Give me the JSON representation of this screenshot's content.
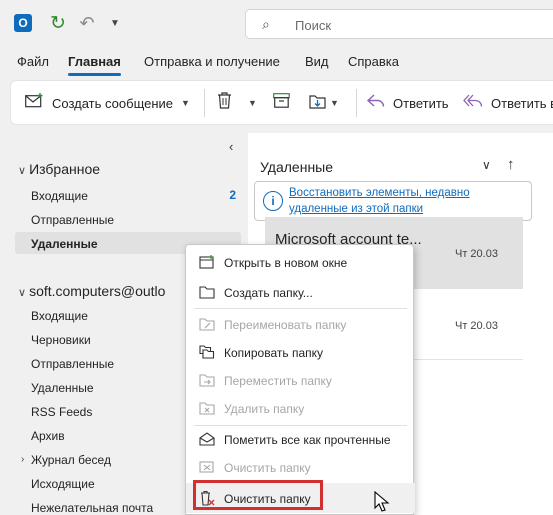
{
  "quick_access": {
    "app_icon": "outlook-icon",
    "sync_icon": "sync-icon",
    "undo_icon": "undo-icon",
    "more_icon": "chevron-down-icon"
  },
  "search": {
    "placeholder": "Поиск"
  },
  "tabs": [
    {
      "label": "Файл"
    },
    {
      "label": "Главная",
      "active": true
    },
    {
      "label": "Отправка и получение"
    },
    {
      "label": "Вид"
    },
    {
      "label": "Справка"
    }
  ],
  "ribbon": {
    "new_message": "Создать сообщение",
    "reply": "Ответить",
    "reply_all": "Ответить в"
  },
  "folders": {
    "favorites_label": "Избранное",
    "favorites": [
      {
        "label": "Входящие",
        "count": "2"
      },
      {
        "label": "Отправленные"
      },
      {
        "label": "Удаленные",
        "selected": true
      }
    ],
    "account_label": "soft.computers@outlo",
    "account_folders": [
      {
        "label": "Входящие"
      },
      {
        "label": "Черновики"
      },
      {
        "label": "Отправленные"
      },
      {
        "label": "Удаленные"
      },
      {
        "label": "RSS Feeds"
      },
      {
        "label": "Архив"
      },
      {
        "label": "Журнал бесед"
      },
      {
        "label": "Исходящие"
      },
      {
        "label": "Нежелательная почта"
      }
    ]
  },
  "message_list": {
    "title": "Удаленные",
    "restore_banner": "Восстановить элементы, недавно удаленные из этой папки",
    "messages": [
      {
        "sender": "Microsoft account te...",
        "date": "Чт 20.03"
      },
      {
        "date": "Чт 20.03"
      }
    ]
  },
  "context_menu": [
    {
      "label": "Открыть в новом окне",
      "icon": "open-window-icon",
      "disabled": false
    },
    {
      "label": "Создать папку...",
      "icon": "new-folder-icon",
      "disabled": false
    },
    {
      "label": "Переименовать папку",
      "icon": "rename-folder-icon",
      "disabled": true
    },
    {
      "label": "Копировать папку",
      "icon": "copy-folder-icon",
      "disabled": false
    },
    {
      "label": "Переместить папку",
      "icon": "move-folder-icon",
      "disabled": true
    },
    {
      "label": "Удалить папку",
      "icon": "delete-folder-icon",
      "disabled": true
    },
    {
      "label": "Пометить все как прочтенные",
      "icon": "mark-read-icon",
      "disabled": false
    },
    {
      "label": "Очистить папку",
      "icon": "clean-folder-icon",
      "disabled": true
    },
    {
      "label": "Очистить папку",
      "icon": "empty-folder-icon",
      "disabled": false,
      "highlighted": true
    }
  ],
  "colors": {
    "accent": "#0f6cbd",
    "highlight_border": "#d22f2f"
  }
}
